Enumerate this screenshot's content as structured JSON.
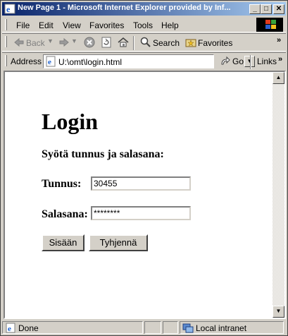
{
  "window": {
    "title": "New Page 1 - Microsoft Internet Explorer provided by Inf...",
    "minimize": "_",
    "maximize": "□",
    "close": "✕"
  },
  "menu": {
    "file": "File",
    "edit": "Edit",
    "view": "View",
    "favorites": "Favorites",
    "tools": "Tools",
    "help": "Help"
  },
  "toolbar": {
    "back": "Back",
    "search": "Search",
    "favorites": "Favorites"
  },
  "address": {
    "label": "Address",
    "value": "U:\\omt\\login.html",
    "go": "Go",
    "links": "Links"
  },
  "page": {
    "title": "Login",
    "subtitle": "Syötä tunnus ja salasana:",
    "username_label": "Tunnus:",
    "username_value": "30455",
    "password_label": "Salasana:",
    "password_value": "********",
    "submit_label": "Sisään",
    "reset_label": "Tyhjennä"
  },
  "status": {
    "text": "Done",
    "zone": "Local intranet"
  },
  "colors": {
    "titlebar_start": "#0a246a",
    "titlebar_end": "#a6caf0",
    "chrome": "#d4d0c8"
  }
}
